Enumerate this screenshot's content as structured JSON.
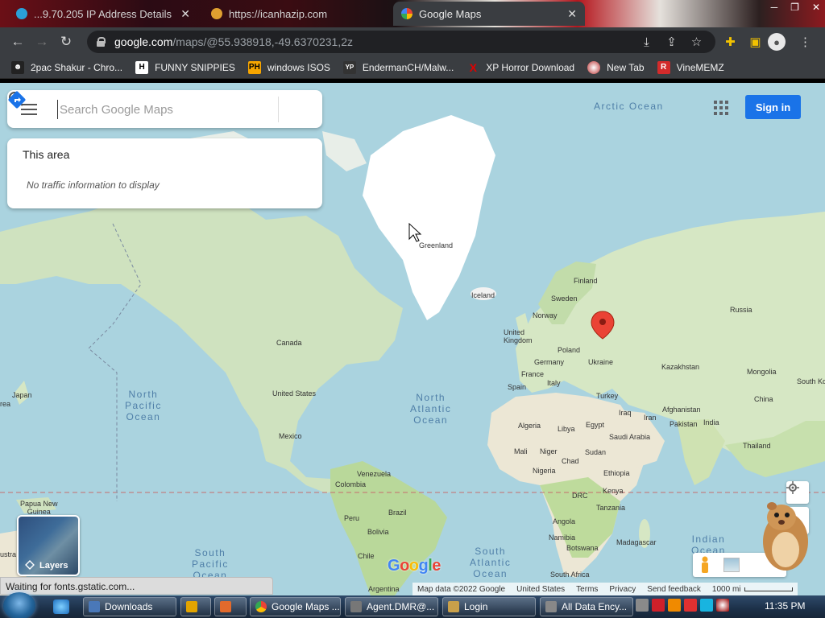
{
  "browser": {
    "tabs": [
      {
        "title": "...9.70.205 IP Address Details",
        "favicon_color": "#2aa0d8",
        "active": false
      },
      {
        "title": "https://icanhazip.com",
        "favicon_color": "#e0a030",
        "active": false
      },
      {
        "title": "Google Maps",
        "favicon_color": "#34a853",
        "active": true
      }
    ],
    "url_host": "google.com",
    "url_path": "/maps/@55.938918,-49.6370231,2z",
    "bookmarks": [
      {
        "label": "2pac Shakur - Chro...",
        "icon": "person-icon",
        "icon_text": "",
        "color": "#444"
      },
      {
        "label": "FUNNY SNIPPIES",
        "icon": "h-icon",
        "icon_text": "H",
        "color": "#fff"
      },
      {
        "label": "windows ISOS",
        "icon": "ph-icon",
        "icon_text": "PH",
        "color": "#f7a600"
      },
      {
        "label": "EndermanCH/Malw...",
        "icon": "yp-icon",
        "icon_text": "YP",
        "color": "#333"
      },
      {
        "label": "XP Horror Download",
        "icon": "x-icon",
        "icon_text": "X",
        "color": "#d40000"
      },
      {
        "label": "New Tab",
        "icon": "globe-icon",
        "icon_text": "",
        "color": "#b33"
      },
      {
        "label": "VineMEMZ",
        "icon": "r-icon",
        "icon_text": "R",
        "color": "#d32b2b"
      }
    ]
  },
  "maps": {
    "search_placeholder": "Search Google Maps",
    "area_title": "This area",
    "area_message": "No traffic information to display",
    "sign_in": "Sign in",
    "layers_label": "Layers",
    "logo": "Google",
    "attribution": [
      "Map data ©2022 Google",
      "United States",
      "Terms",
      "Privacy",
      "Send feedback"
    ],
    "scale_label": "1000 mi",
    "status": "Waiting for fonts.gstatic.com...",
    "oceans": {
      "arctic": "Arctic Ocean",
      "north_pacific": "North\nPacific\nOcean",
      "north_atlantic": "North\nAtlantic\nOcean",
      "south_pacific": "South\nPacific\nOcean",
      "south_atlantic": "South\nAtlantic\nOcean",
      "indian": "Indian\nOcean"
    },
    "labels": {
      "greenland": "Greenland",
      "iceland": "Iceland",
      "finland": "Finland",
      "sweden": "Sweden",
      "norway": "Norway",
      "russia": "Russia",
      "united_kingdom": "United\nKingdom",
      "poland": "Poland",
      "germany": "Germany",
      "ukraine": "Ukraine",
      "france": "France",
      "kazakhstan": "Kazakhstan",
      "mongolia": "Mongolia",
      "spain": "Spain",
      "italy": "Italy",
      "turkey": "Turkey",
      "china": "China",
      "south_korea": "South Ko",
      "iraq": "Iraq",
      "iran": "Iran",
      "afghanistan": "Afghanistan",
      "pakistan": "Pakistan",
      "algeria": "Algeria",
      "libya": "Libya",
      "egypt": "Egypt",
      "saudi_arabia": "Saudi Arabia",
      "india": "India",
      "thailand": "Thailand",
      "mali": "Mali",
      "niger": "Niger",
      "chad": "Chad",
      "sudan": "Sudan",
      "nigeria": "Nigeria",
      "ethiopia": "Ethiopia",
      "kenya": "Kenya",
      "drc": "DRC",
      "tanzania": "Tanzania",
      "angola": "Angola",
      "namibia": "Namibia",
      "botswana": "Botswana",
      "madagascar": "Madagascar",
      "south_africa": "South Africa",
      "canada": "Canada",
      "united_states": "United States",
      "mexico": "Mexico",
      "japan": "Japan",
      "venezuela": "Venezuela",
      "colombia": "Colombia",
      "peru": "Peru",
      "brazil": "Brazil",
      "bolivia": "Bolivia",
      "chile": "Chile",
      "argentina": "Argentina",
      "papua": "Papua New\nGuinea",
      "rea": "rea",
      "ustra": "ustra"
    }
  },
  "taskbar": {
    "tasks": [
      {
        "label": "Downloads",
        "color": "#4a78b8"
      },
      {
        "label": "",
        "color": "#e2a400"
      },
      {
        "label": "",
        "color": "#e26a2c"
      },
      {
        "label": "Google Maps ...",
        "color": "#34a853"
      },
      {
        "label": "Agent.DMR@...",
        "color": "#777"
      },
      {
        "label": "Login",
        "color": "#c9a04a"
      },
      {
        "label": "All Data Ency...",
        "color": "#888"
      }
    ],
    "time": "11:35 PM"
  }
}
